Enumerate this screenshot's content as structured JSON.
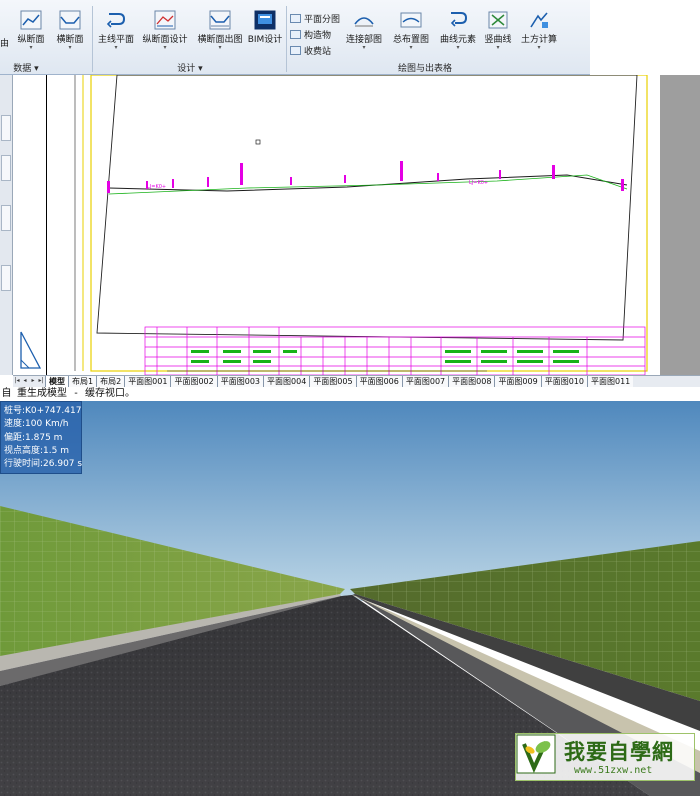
{
  "ribbon": {
    "tools": [
      {
        "label": "纵断面",
        "icon": "profile-icon"
      },
      {
        "label": "横断面",
        "icon": "cross-section-icon"
      },
      {
        "label": "主线平面",
        "icon": "main-plane-icon"
      },
      {
        "label": "纵断面设计",
        "icon": "profile-design-icon"
      },
      {
        "label": "横断面出图",
        "icon": "cross-section-drawing-icon"
      },
      {
        "label": "BIM设计",
        "icon": "bim-icon"
      },
      {
        "label": "连接部图",
        "icon": "connection-icon"
      },
      {
        "label": "总布置图",
        "icon": "layout-icon"
      },
      {
        "label": "曲线元素",
        "icon": "curve-icon"
      },
      {
        "label": "竖曲线",
        "icon": "vertical-curve-icon"
      },
      {
        "label": "土方计算",
        "icon": "earthwork-icon"
      }
    ],
    "small_tools": [
      "平面分图",
      "构造物",
      "收费站"
    ],
    "groups": [
      "数据",
      "设计",
      "绘图与出表格"
    ],
    "partial_label": "由"
  },
  "layout_tabs": [
    "模型",
    "布局1",
    "布局2",
    "平面图001",
    "平面图002",
    "平面图003",
    "平面图004",
    "平面图005",
    "平面图006",
    "平面图007",
    "平面图008",
    "平面图009",
    "平面图010",
    "平面图011"
  ],
  "command_line": {
    "lead": "自",
    "text": "重生成模型 - 缓存视口。"
  },
  "viewer": {
    "info": {
      "station": "桩号:K0+747.417",
      "speed": "速度:100  Km/h",
      "offset": "偏距:1.875  m",
      "eye_height": "视点高度:1.5  m",
      "drive_time": "行驶时间:26.907  s"
    }
  },
  "watermark": {
    "title": "我要自學網",
    "url": "www.51zxw.net"
  },
  "colors": {
    "sky_top": "#4f88bd",
    "sky_bottom": "#bcd6e6",
    "asphalt": "#3d3d40",
    "slope_green": "#6d8a3a",
    "info_panel": "#2660aa",
    "cad_gray": "#9e9e9e"
  }
}
